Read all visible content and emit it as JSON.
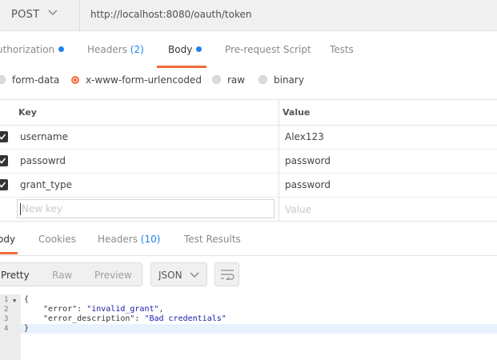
{
  "request": {
    "method": "POST",
    "url": "http://localhost:8080/oauth/token"
  },
  "request_tabs": [
    {
      "label": "uthorization",
      "dot": true
    },
    {
      "label": "Headers",
      "count": "(2)"
    },
    {
      "label": "Body",
      "dot": true,
      "active": true
    },
    {
      "label": "Pre-request Script"
    },
    {
      "label": "Tests"
    }
  ],
  "body_types": [
    {
      "label": "form-data",
      "selected": false
    },
    {
      "label": "x-www-form-urlencoded",
      "selected": true
    },
    {
      "label": "raw",
      "selected": false
    },
    {
      "label": "binary",
      "selected": false
    }
  ],
  "params": {
    "headers": {
      "key": "Key",
      "value": "Value"
    },
    "rows": [
      {
        "key": "username",
        "value": "Alex123",
        "checked": true
      },
      {
        "key": "passowrd",
        "value": "password",
        "checked": true
      },
      {
        "key": "grant_type",
        "value": "password",
        "checked": true
      }
    ],
    "new_key_placeholder": "New key",
    "new_value_placeholder": "Value"
  },
  "response_tabs": [
    {
      "label": "ody",
      "active": true
    },
    {
      "label": "Cookies"
    },
    {
      "label": "Headers",
      "count": "(10)"
    },
    {
      "label": "Test Results"
    }
  ],
  "response_toolbar": {
    "view_modes": [
      "Pretty",
      "Raw",
      "Preview"
    ],
    "active_mode": "Pretty",
    "format": "JSON"
  },
  "response_body": {
    "lines": [
      {
        "n": "1",
        "text": "{",
        "fold": true
      },
      {
        "n": "2",
        "key": "\"error\"",
        "sep": ": ",
        "val": "\"invalid_grant\"",
        "tail": ","
      },
      {
        "n": "3",
        "key": "\"error_description\"",
        "sep": ": ",
        "val": "\"Bad credentials\"",
        "tail": ""
      },
      {
        "n": "4",
        "text": "}",
        "highlight": true
      }
    ]
  },
  "colors": {
    "accent": "#f26b3a",
    "link": "#1c84ee",
    "gutter": "#ececec",
    "toolbar_bg": "#f0f0f0"
  }
}
